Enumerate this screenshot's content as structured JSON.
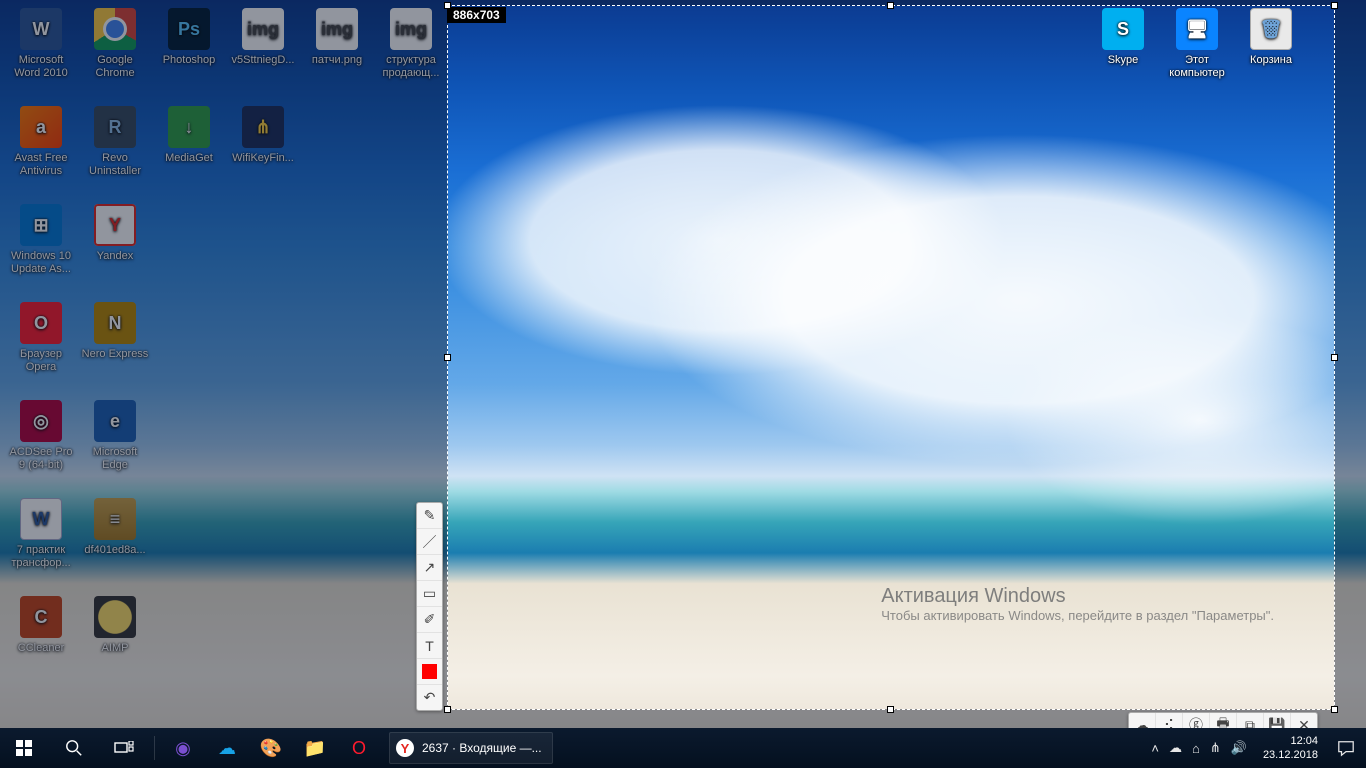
{
  "capture": {
    "size_label": "886x703"
  },
  "watermark": {
    "title": "Активация Windows",
    "line": "Чтобы активировать Windows, перейдите в раздел \"Параметры\"."
  },
  "icons_left": [
    {
      "label": "Microsoft Word 2010",
      "g": "g-word",
      "sym": "W"
    },
    {
      "label": "Google Chrome",
      "g": "g-chrome",
      "sym": ""
    },
    {
      "label": "Photoshop",
      "g": "g-ps",
      "sym": "Ps"
    },
    {
      "label": "v5SttniegD...",
      "g": "g-img",
      "sym": "img"
    },
    {
      "label": "патчи.png",
      "g": "g-img",
      "sym": "img"
    },
    {
      "label": "структура продающ...",
      "g": "g-img",
      "sym": "img"
    },
    {
      "label": "Avast Free Antivirus",
      "g": "g-avast",
      "sym": "a"
    },
    {
      "label": "Revo Uninstaller",
      "g": "g-revo",
      "sym": "R"
    },
    {
      "label": "MediaGet",
      "g": "g-media",
      "sym": "↓"
    },
    {
      "label": "WifiKeyFin...",
      "g": "g-wifi",
      "sym": "⋔"
    },
    {
      "label": "",
      "g": "",
      "sym": "",
      "empty": true
    },
    {
      "label": "",
      "g": "",
      "sym": "",
      "empty": true
    },
    {
      "label": "Windows 10 Update As...",
      "g": "g-win",
      "sym": "⊞"
    },
    {
      "label": "Yandex",
      "g": "g-yandex",
      "sym": "Y"
    },
    {
      "label": "",
      "g": "",
      "sym": "",
      "empty": true
    },
    {
      "label": "",
      "g": "",
      "sym": "",
      "empty": true
    },
    {
      "label": "",
      "g": "",
      "sym": "",
      "empty": true
    },
    {
      "label": "",
      "g": "",
      "sym": "",
      "empty": true
    },
    {
      "label": "Браузер Opera",
      "g": "g-opera",
      "sym": "O"
    },
    {
      "label": "Nero Express",
      "g": "g-nero",
      "sym": "N"
    },
    {
      "label": "",
      "g": "",
      "sym": "",
      "empty": true
    },
    {
      "label": "",
      "g": "",
      "sym": "",
      "empty": true
    },
    {
      "label": "",
      "g": "",
      "sym": "",
      "empty": true
    },
    {
      "label": "",
      "g": "",
      "sym": "",
      "empty": true
    },
    {
      "label": "ACDSee Pro 9 (64-bit)",
      "g": "g-acd",
      "sym": "◎"
    },
    {
      "label": "Microsoft Edge",
      "g": "g-edge",
      "sym": "e"
    },
    {
      "label": "",
      "g": "",
      "sym": "",
      "empty": true
    },
    {
      "label": "",
      "g": "",
      "sym": "",
      "empty": true
    },
    {
      "label": "",
      "g": "",
      "sym": "",
      "empty": true
    },
    {
      "label": "",
      "g": "",
      "sym": "",
      "empty": true
    },
    {
      "label": "7 практик трансфор...",
      "g": "g-doc",
      "sym": "W"
    },
    {
      "label": "df401ed8a...",
      "g": "g-xl",
      "sym": "≡"
    },
    {
      "label": "",
      "g": "",
      "sym": "",
      "empty": true
    },
    {
      "label": "",
      "g": "",
      "sym": "",
      "empty": true
    },
    {
      "label": "",
      "g": "",
      "sym": "",
      "empty": true
    },
    {
      "label": "",
      "g": "",
      "sym": "",
      "empty": true
    },
    {
      "label": "CCleaner",
      "g": "g-ccl",
      "sym": "C"
    },
    {
      "label": "AIMP",
      "g": "g-aimp",
      "sym": ""
    }
  ],
  "icons_right": [
    {
      "label": "Skype",
      "g": "g-skype",
      "sym": "S"
    },
    {
      "label": "Этот компьютер",
      "g": "g-pc",
      "sym": "🖥"
    },
    {
      "label": "Корзина",
      "g": "g-bin",
      "sym": "🗑"
    }
  ],
  "tool_palette": [
    {
      "name": "pen-tool",
      "sym": "✎"
    },
    {
      "name": "line-tool",
      "sym": "／"
    },
    {
      "name": "arrow-tool",
      "sym": "↗"
    },
    {
      "name": "rect-tool",
      "sym": "▭"
    },
    {
      "name": "marker-tool",
      "sym": "✐"
    },
    {
      "name": "text-tool",
      "sym": "T"
    },
    {
      "name": "color-picker",
      "sym": "",
      "swatch": true
    },
    {
      "name": "undo-tool",
      "sym": "↶"
    }
  ],
  "action_bar": [
    {
      "name": "upload-button",
      "sym": "☁"
    },
    {
      "name": "share-button",
      "sym": "⠪"
    },
    {
      "name": "search-button",
      "sym": "ⓖ"
    },
    {
      "name": "print-button",
      "sym": "🖶"
    },
    {
      "name": "copy-button",
      "sym": "⧉"
    },
    {
      "name": "save-button",
      "sym": "💾"
    },
    {
      "name": "close-button",
      "sym": "✕"
    }
  ],
  "taskbar": {
    "task_label": "2637 · Входящие —...",
    "task_count": "2637",
    "pinned": [
      {
        "name": "cortana-icon",
        "sym": "◉",
        "color": "#7a4fcf"
      },
      {
        "name": "onedrive-icon",
        "sym": "☁",
        "color": "#17a2e6"
      },
      {
        "name": "paint-icon",
        "sym": "🎨",
        "color": "#ff944d"
      },
      {
        "name": "explorer-icon",
        "sym": "📁",
        "color": "#f5c46a"
      },
      {
        "name": "opera-icon",
        "sym": "O",
        "color": "#ff1b2d"
      }
    ],
    "tray": [
      {
        "name": "tray-chevron-icon",
        "sym": "˄"
      },
      {
        "name": "tray-onedrive-icon",
        "sym": "☁"
      },
      {
        "name": "tray-network-icon",
        "sym": "⌂"
      },
      {
        "name": "tray-wifi-icon",
        "sym": "⋔"
      },
      {
        "name": "tray-volume-icon",
        "sym": "🔊"
      }
    ],
    "time": "12:04",
    "date": "23.12.2018"
  }
}
